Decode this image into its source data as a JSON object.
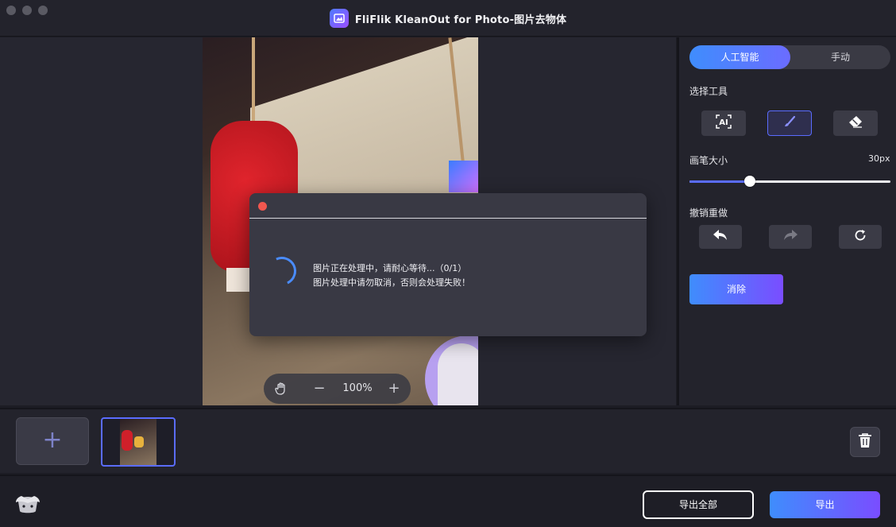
{
  "window": {
    "title": "FliFlik KleanOut for Photo-图片去物体",
    "app_icon": "photo-edit-icon"
  },
  "canvas": {
    "zoom": {
      "level": "100%",
      "minus": "−",
      "plus": "+"
    }
  },
  "dialog": {
    "message_line1": "图片正在处理中，请耐心等待...（0/1）",
    "message_line2": "图片处理中请勿取消，否则会处理失败！"
  },
  "panel": {
    "mode_tabs": {
      "ai": "人工智能",
      "manual": "手动",
      "active": "ai"
    },
    "select_tool_label": "选择工具",
    "tools": [
      {
        "name": "ai-select",
        "icon": "ai-select-icon"
      },
      {
        "name": "brush",
        "icon": "brush-icon",
        "active": true
      },
      {
        "name": "eraser",
        "icon": "eraser-icon"
      }
    ],
    "brush_size": {
      "label": "画笔大小",
      "value": "30px",
      "fraction": 0.3
    },
    "history_label": "撤销重做",
    "history": [
      {
        "name": "undo",
        "icon": "undo-icon"
      },
      {
        "name": "redo",
        "icon": "redo-icon"
      },
      {
        "name": "reset",
        "icon": "reset-icon"
      }
    ],
    "erase_button": "消除"
  },
  "strip": {
    "add_button": "+",
    "trash_icon": "trash-icon"
  },
  "footer": {
    "export_all": "导出全部",
    "export": "导出"
  },
  "colors": {
    "accent_start": "#3f8dfd",
    "accent_end": "#7a4dff",
    "close_dot": "#f2574f"
  }
}
